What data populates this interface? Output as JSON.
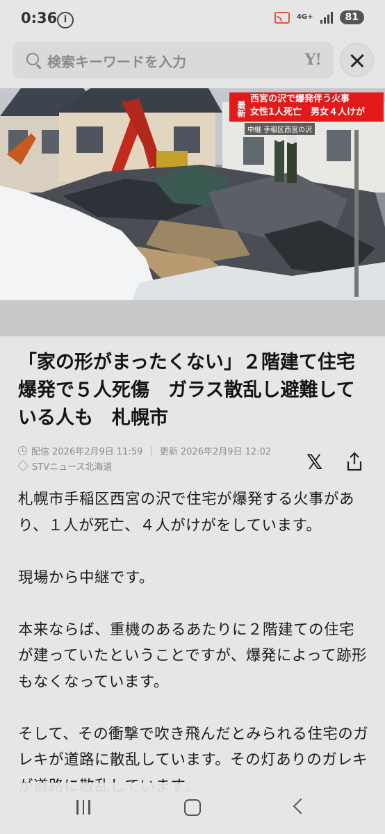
{
  "status_bar": {
    "time": "0:36",
    "network": "4G+",
    "battery": "81"
  },
  "search": {
    "placeholder": "検索キーワードを入力",
    "logo": "Y!"
  },
  "hero": {
    "badge": "最新",
    "headline_line1": "西宮の沢で爆発伴う火事",
    "headline_line2": "女性1人死亡　男女４人けが",
    "live_label": "中継",
    "location": "手稲区西宮の沢"
  },
  "article": {
    "title": "「家の形がまったくない」２階建て住宅爆発で５人死傷　ガラス散乱し避難している人も　札幌市",
    "published": "配信 2026年2月9日 11:59",
    "updated": "更新 2026年2月9日 12:02",
    "source": "STVニュース北海道",
    "paragraphs": [
      "札幌市手稲区西宮の沢で住宅が爆発する火事があり、１人が死亡、４人がけがをしています。",
      "現場から中継です。",
      "本来ならば、重機のあるあたりに２階建ての住宅が建っていたということですが、爆発によって跡形もなくなっています。",
      "そして、その衝撃で吹き飛んだとみられる住宅のガレキが道路に散乱しています。その灯ありのガレキが道路に散乱しています。"
    ]
  },
  "share": {
    "x_label": "𝕏"
  },
  "icons": [
    "info-icon",
    "cast-icon",
    "signal-icon",
    "search-icon",
    "close-icon",
    "clock-icon",
    "publisher-icon",
    "share-icon",
    "recent-apps-icon",
    "home-icon",
    "back-icon"
  ]
}
